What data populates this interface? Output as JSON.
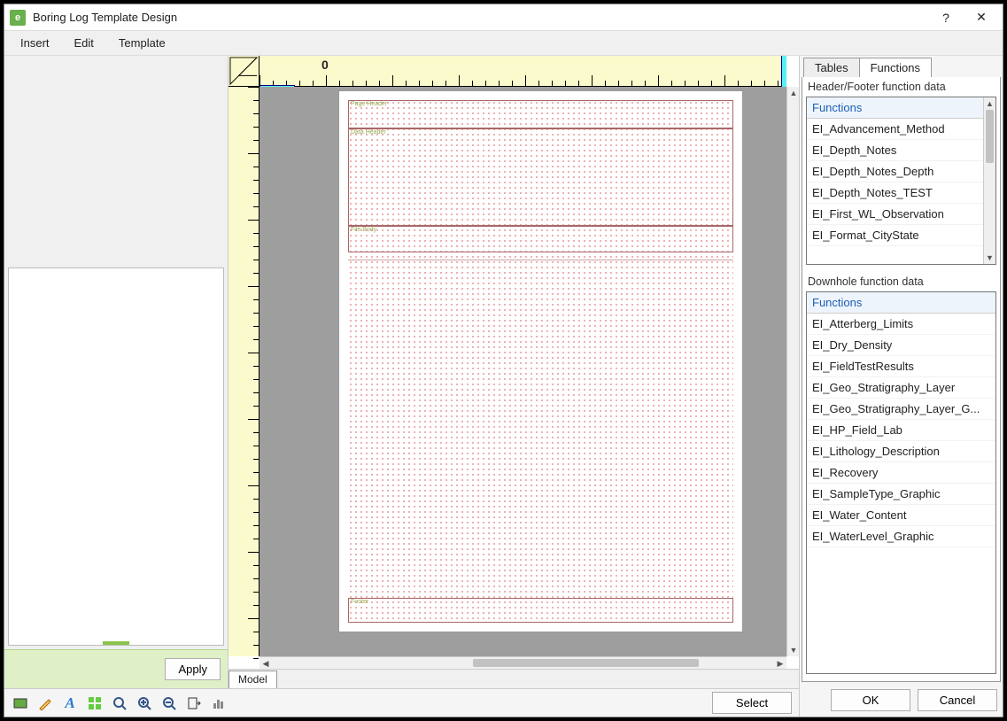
{
  "titlebar": {
    "title": "Boring Log Template Design"
  },
  "menu": {
    "insert": "Insert",
    "edit": "Edit",
    "template": "Template"
  },
  "left": {
    "apply": "Apply"
  },
  "canvas": {
    "ruler_zero": "0",
    "model_tab": "Model",
    "bands": {
      "page_header": "Page Header",
      "data_header": "Data Header",
      "file_body": "File Body",
      "footer": "Footer"
    }
  },
  "right": {
    "tabs": {
      "tables": "Tables",
      "functions": "Functions"
    },
    "header_label": "Header/Footer function data",
    "header_listhead": "Functions",
    "header_items": [
      "EI_Advancement_Method",
      "EI_Depth_Notes",
      "EI_Depth_Notes_Depth",
      "EI_Depth_Notes_TEST",
      "EI_First_WL_Observation",
      "EI_Format_CityState"
    ],
    "downhole_label": "Downhole function data",
    "downhole_listhead": "Functions",
    "downhole_items": [
      "EI_Atterberg_Limits",
      "EI_Dry_Density",
      "EI_FieldTestResults",
      "EI_Geo_Stratigraphy_Layer",
      "EI_Geo_Stratigraphy_Layer_G...",
      "EI_HP_Field_Lab",
      "EI_Lithology_Description",
      "EI_Recovery",
      "EI_SampleType_Graphic",
      "EI_Water_Content",
      "EI_WaterLevel_Graphic"
    ]
  },
  "bottom": {
    "select": "Select",
    "ok": "OK",
    "cancel": "Cancel"
  }
}
